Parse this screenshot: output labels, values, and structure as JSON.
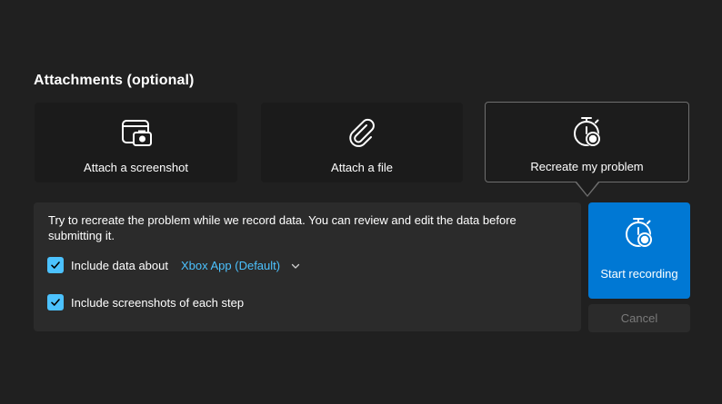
{
  "section_title": "Attachments (optional)",
  "cards": [
    {
      "label": "Attach a screenshot",
      "icon": "screenshot-camera-icon"
    },
    {
      "label": "Attach a file",
      "icon": "paperclip-icon"
    },
    {
      "label": "Recreate my problem",
      "icon": "stopwatch-record-icon"
    }
  ],
  "panel": {
    "description": "Try to recreate the problem while we record data. You can review and edit the data before submitting it.",
    "include_data_label": "Include data about",
    "app_select_value": "Xbox App (Default)",
    "include_screenshots_label": "Include screenshots of each step",
    "include_data_checked": true,
    "include_screenshots_checked": true
  },
  "actions": {
    "start_recording": "Start recording",
    "cancel": "Cancel"
  },
  "colors": {
    "accent": "#0078d4",
    "link": "#4cc2ff",
    "background": "#202020"
  }
}
